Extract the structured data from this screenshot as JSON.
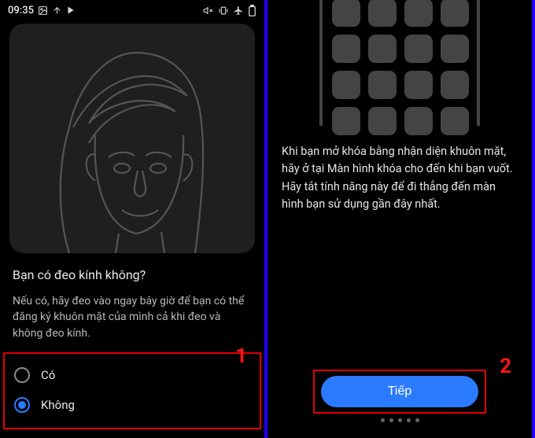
{
  "statusbar": {
    "time": "09:35",
    "left_icons": [
      "image-icon",
      "upload-icon",
      "play-icon"
    ],
    "right_icons": [
      "mute-icon",
      "vibrate-icon",
      "airplane-icon",
      "battery-icon"
    ]
  },
  "left": {
    "question_title": "Bạn có đeo kính không?",
    "question_desc": "Nếu có, hãy đeo vào ngay bây giờ để bạn có thể đăng ký khuôn mặt của mình cả khi đeo và không đeo kính.",
    "options": [
      {
        "label": "Có",
        "selected": false
      },
      {
        "label": "Không",
        "selected": true
      }
    ],
    "annotation": "1"
  },
  "right": {
    "info_text": "Khi bạn mở khóa bằng nhận diện khuôn mặt, hãy ở tại Màn hình khóa cho đến khi bạn vuốt. Hãy tắt tính năng này để đi thẳng đến màn hình bạn sử dụng gần đây nhất.",
    "button_label": "Tiếp",
    "annotation": "2"
  },
  "colors": {
    "accent": "#2a7bff",
    "highlight_box": "#e10000",
    "annotation_text": "#ff1515"
  }
}
